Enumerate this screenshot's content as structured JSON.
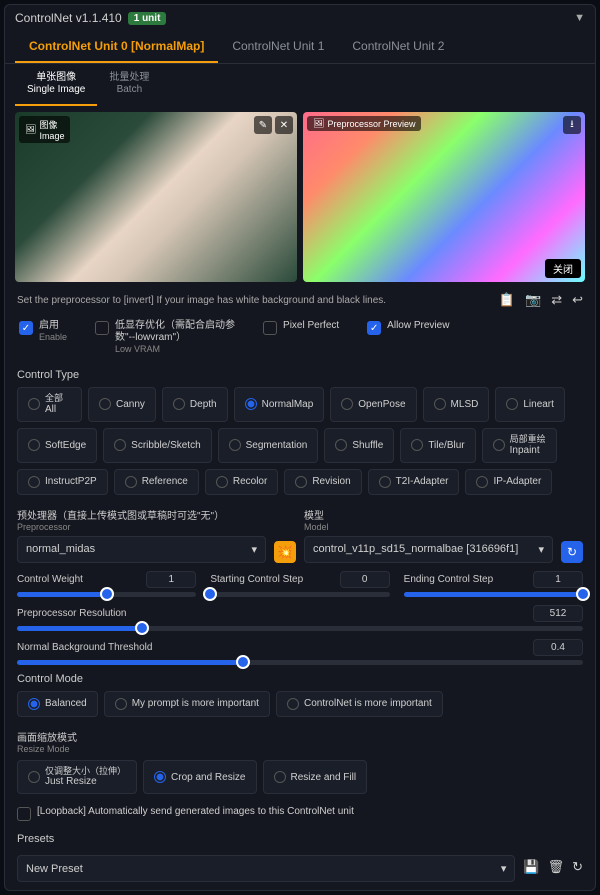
{
  "header": {
    "title": "ControlNet v1.1.410",
    "badge": "1 unit"
  },
  "unit_tabs": [
    {
      "label": "ControlNet Unit 0 [NormalMap]",
      "active": true
    },
    {
      "label": "ControlNet Unit 1",
      "active": false
    },
    {
      "label": "ControlNet Unit 2",
      "active": false
    }
  ],
  "image_tabs": [
    {
      "cn": "单张图像",
      "en": "Single Image",
      "active": true
    },
    {
      "cn": "批量处理",
      "en": "Batch",
      "active": false
    }
  ],
  "source_image": {
    "label_cn": "图像",
    "label_en": "Image"
  },
  "preview_image": {
    "label": "Preprocessor Preview",
    "close": "关闭"
  },
  "hint": "Set the preprocessor to [invert] If your image has white background and black lines.",
  "checks": {
    "enable": {
      "cn": "启用",
      "en": "Enable",
      "checked": true
    },
    "lowvram": {
      "cn": "低显存优化（需配合启动参数\"--lowvram\"）",
      "en": "Low VRAM",
      "checked": false
    },
    "pixel": {
      "label": "Pixel Perfect",
      "checked": false
    },
    "preview": {
      "label": "Allow Preview",
      "checked": true
    }
  },
  "control_type": {
    "title": "Control Type",
    "options": [
      {
        "cn": "全部",
        "en": "All"
      },
      {
        "en": "Canny"
      },
      {
        "en": "Depth"
      },
      {
        "en": "NormalMap",
        "selected": true
      },
      {
        "en": "OpenPose"
      },
      {
        "en": "MLSD"
      },
      {
        "en": "Lineart"
      },
      {
        "en": "SoftEdge"
      },
      {
        "en": "Scribble/Sketch"
      },
      {
        "en": "Segmentation"
      },
      {
        "en": "Shuffle"
      },
      {
        "en": "Tile/Blur"
      },
      {
        "cn": "局部重绘",
        "en": "Inpaint"
      },
      {
        "en": "InstructP2P"
      },
      {
        "en": "Reference"
      },
      {
        "en": "Recolor"
      },
      {
        "en": "Revision"
      },
      {
        "en": "T2I-Adapter"
      },
      {
        "en": "IP-Adapter"
      }
    ]
  },
  "preprocessor": {
    "label_cn": "预处理器（直接上传模式图或草稿时可选\"无\"）",
    "label_en": "Preprocessor",
    "value": "normal_midas"
  },
  "model": {
    "label_cn": "模型",
    "label_en": "Model",
    "value": "control_v11p_sd15_normalbae [316696f1]"
  },
  "sliders": {
    "weight": {
      "label": "Control Weight",
      "value": "1",
      "pct": 50
    },
    "start": {
      "label": "Starting Control Step",
      "value": "0",
      "pct": 0
    },
    "end": {
      "label": "Ending Control Step",
      "value": "1",
      "pct": 100
    },
    "res": {
      "label": "Preprocessor Resolution",
      "value": "512",
      "pct": 22
    },
    "thresh": {
      "label": "Normal Background Threshold",
      "value": "0.4",
      "pct": 40
    }
  },
  "control_mode": {
    "title": "Control Mode",
    "options": [
      {
        "label": "Balanced",
        "selected": true
      },
      {
        "label": "My prompt is more important"
      },
      {
        "label": "ControlNet is more important"
      }
    ]
  },
  "resize_mode": {
    "title_cn": "画面缩放模式",
    "title_en": "Resize Mode",
    "options": [
      {
        "cn": "仅调整大小（拉伸）",
        "en": "Just Resize"
      },
      {
        "en": "Crop and Resize",
        "selected": true
      },
      {
        "en": "Resize and Fill"
      }
    ]
  },
  "loopback": {
    "label": "[Loopback] Automatically send generated images to this ControlNet unit",
    "checked": false
  },
  "presets": {
    "title": "Presets",
    "value": "New Preset"
  }
}
